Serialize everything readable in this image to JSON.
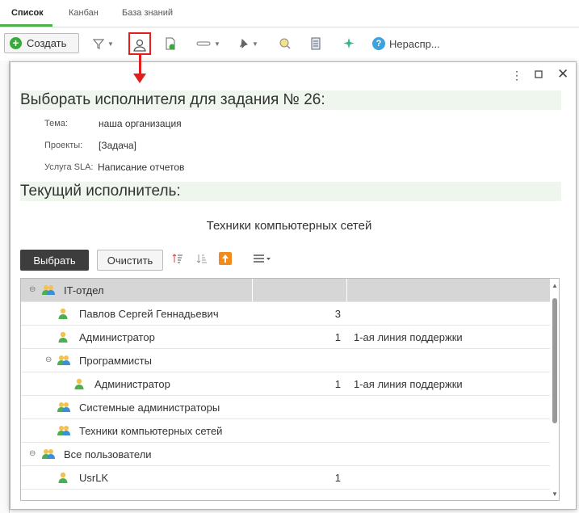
{
  "tabs": [
    {
      "label": "Список"
    },
    {
      "label": "Канбан"
    },
    {
      "label": "База знаний"
    }
  ],
  "toolbar": {
    "create_label": "Создать",
    "unassigned_label": "Нераспр..."
  },
  "dialog": {
    "title": "Выборать исполнителя для задания № 26:",
    "fields": [
      {
        "label": "Тема:",
        "value": "наша организация"
      },
      {
        "label": "Проекты:",
        "value": "[Задача]"
      },
      {
        "label": "Услуга SLA:",
        "value": "Написание отчетов"
      }
    ],
    "current_title": "Текущий исполнитель:",
    "current_value": "Техники компьютерных сетей",
    "select_label": "Выбрать",
    "clear_label": "Очистить"
  },
  "rows": [
    {
      "name": "IT-отдел",
      "num": "",
      "role": "",
      "type": "group",
      "toggle": "⊖"
    },
    {
      "name": "Павлов Сергей Геннадьевич",
      "num": "3",
      "role": "",
      "type": "user"
    },
    {
      "name": "Администратор",
      "num": "1",
      "role": "1-ая линия поддержки",
      "type": "user"
    },
    {
      "name": "Программисты",
      "num": "",
      "role": "",
      "type": "group",
      "toggle": "⊖"
    },
    {
      "name": "Администратор",
      "num": "1",
      "role": "1-ая линия поддержки",
      "type": "user"
    },
    {
      "name": "Системные администраторы",
      "num": "",
      "role": "",
      "type": "group"
    },
    {
      "name": "Техники компьютерных сетей",
      "num": "",
      "role": "",
      "type": "group"
    },
    {
      "name": "Все пользователи",
      "num": "",
      "role": "",
      "type": "group",
      "toggle": "⊖"
    },
    {
      "name": "UsrLK",
      "num": "1",
      "role": "",
      "type": "user"
    }
  ]
}
